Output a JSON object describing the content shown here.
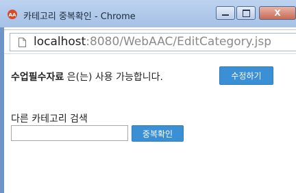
{
  "window": {
    "title": "카테고리 중복확인 - Chrome",
    "close_label": "X"
  },
  "address": {
    "host": "localhost",
    "path": ":8080/WebAAC/EditCategory.jsp"
  },
  "message": {
    "category_name": "수업필수자료",
    "suffix": " 은(는) 사용 가능합니다.",
    "edit_button": "수정하기"
  },
  "search": {
    "label": "다른 카테고리 검색",
    "input_value": "",
    "check_button": "중복확인"
  },
  "colors": {
    "button_blue": "#3b8fd4",
    "titlebar": "#bcd2ef"
  },
  "icons": {
    "app": "app-icon",
    "page": "page-icon",
    "minimize": "minimize-icon",
    "maximize": "maximize-icon"
  }
}
